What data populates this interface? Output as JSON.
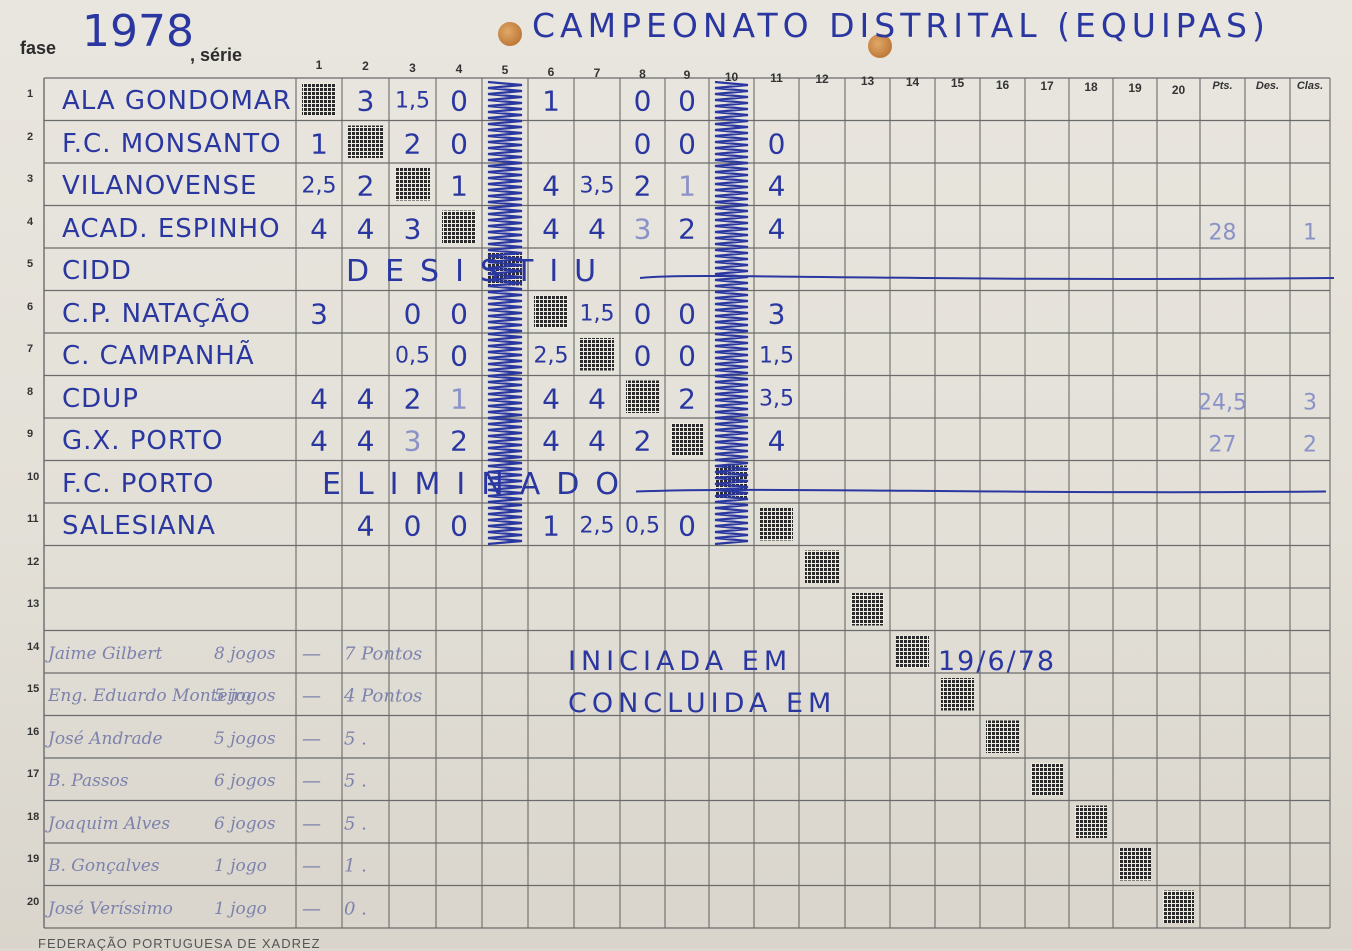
{
  "header": {
    "fase_label": "fase",
    "year": "1978",
    "serie_label": ", série",
    "title": "CAMPEONATO DISTRITAL (EQUIPAS)"
  },
  "columns": {
    "numbers": [
      "1",
      "2",
      "3",
      "4",
      "5",
      "6",
      "7",
      "8",
      "9",
      "10",
      "11",
      "12",
      "13",
      "14",
      "15",
      "16",
      "17",
      "18",
      "19",
      "20"
    ],
    "pts": "Pts.",
    "des": "Des.",
    "clas": "Clas."
  },
  "rows": {
    "numbers": [
      "1",
      "2",
      "3",
      "4",
      "5",
      "6",
      "7",
      "8",
      "9",
      "10",
      "11",
      "12",
      "13",
      "14",
      "15",
      "16",
      "17",
      "18",
      "19",
      "20"
    ]
  },
  "teams": [
    {
      "name": "ALA GONDOMAR",
      "scores": [
        "",
        "3",
        "1,5",
        "0",
        "",
        "1",
        "",
        "0",
        "0",
        "",
        ""
      ],
      "pts": "",
      "clas": ""
    },
    {
      "name": "F.C. MONSANTO",
      "scores": [
        "1",
        "",
        "2",
        "0",
        "",
        "",
        "",
        "0",
        "0",
        "",
        "0"
      ],
      "pts": "",
      "clas": ""
    },
    {
      "name": "VILANOVENSE",
      "scores": [
        "2,5",
        "2",
        "",
        "1",
        "",
        "4",
        "3,5",
        "2",
        "1",
        "",
        "4"
      ],
      "pts": "",
      "clas": ""
    },
    {
      "name": "ACAD. ESPINHO",
      "scores": [
        "4",
        "4",
        "3",
        "",
        "",
        "4",
        "4",
        "3",
        "2",
        "",
        "4"
      ],
      "pts": "28",
      "clas": "1"
    },
    {
      "name": "CIDD",
      "note": "DESISTIU"
    },
    {
      "name": "C.P. NATAÇÃO",
      "scores": [
        "3",
        "",
        "0",
        "0",
        "",
        "",
        "1,5",
        "0",
        "0",
        "",
        "3"
      ],
      "pts": "",
      "clas": ""
    },
    {
      "name": "C. CAMPANHÃ",
      "scores": [
        "",
        "",
        "0,5",
        "0",
        "",
        "2,5",
        "",
        "0",
        "0",
        "",
        "1,5"
      ],
      "pts": "",
      "clas": ""
    },
    {
      "name": "CDUP",
      "scores": [
        "4",
        "4",
        "2",
        "1",
        "",
        "4",
        "4",
        "",
        "2",
        "",
        "3,5"
      ],
      "pts": "24,5",
      "clas": "3"
    },
    {
      "name": "G.X. PORTO",
      "scores": [
        "4",
        "4",
        "3",
        "2",
        "",
        "4",
        "4",
        "2",
        "",
        "",
        "4"
      ],
      "pts": "27",
      "clas": "2"
    },
    {
      "name": "F.C. PORTO",
      "note": "ELIMINADO"
    },
    {
      "name": "SALESIANA",
      "scores": [
        "",
        "4",
        "0",
        "0",
        "",
        "1",
        "2,5",
        "0,5",
        "0",
        "",
        ""
      ],
      "pts": "",
      "clas": ""
    }
  ],
  "notes": {
    "started_label": "INICIADA EM",
    "started_date": "19/6/78",
    "finished_label": "CONCLUIDA EM"
  },
  "scorers": [
    {
      "name": "Jaime Gilbert",
      "games": "8 jogos",
      "dash": "—",
      "points": "7 Pontos"
    },
    {
      "name": "Eng. Eduardo Monteiro",
      "games": "5 jogos",
      "dash": "—",
      "points": "4 Pontos"
    },
    {
      "name": "José Andrade",
      "games": "5 jogos",
      "dash": "—",
      "points": "5 ."
    },
    {
      "name": "B. Passos",
      "games": "6 jogos",
      "dash": "—",
      "points": "5 ."
    },
    {
      "name": "Joaquim Alves",
      "games": "6 jogos",
      "dash": "—",
      "points": "5 ."
    },
    {
      "name": "B. Gonçalves",
      "games": "1 jogo",
      "dash": "—",
      "points": "1 ."
    },
    {
      "name": "José Veríssimo",
      "games": "1 jogo",
      "dash": "—",
      "points": "0 ."
    }
  ],
  "footer": "FEDERAÇÃO PORTUGUESA DE XADREZ",
  "colors": {
    "ink": "#2a37a0",
    "grid": "#6b6b6b",
    "paper": "#e6e3dc"
  }
}
